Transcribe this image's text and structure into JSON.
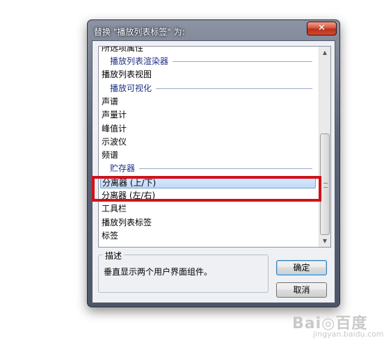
{
  "window": {
    "title": "替换 \"播放列表标签\" 为:",
    "close_glyph": "✕"
  },
  "list": {
    "partial_top_item": "所选项属性",
    "items": [
      {
        "kind": "group",
        "label": "播放列表渲染器"
      },
      {
        "kind": "item",
        "label": "播放列表视图"
      },
      {
        "kind": "group",
        "label": "播放可视化"
      },
      {
        "kind": "item",
        "label": "声谱"
      },
      {
        "kind": "item",
        "label": "声量计"
      },
      {
        "kind": "item",
        "label": "峰值计"
      },
      {
        "kind": "item",
        "label": "示波仪"
      },
      {
        "kind": "item",
        "label": "频谱"
      },
      {
        "kind": "group",
        "label": "贮存器"
      },
      {
        "kind": "item",
        "label": "分离器 (上/下)",
        "selected": true
      },
      {
        "kind": "item",
        "label": "分离器 (左/右)"
      },
      {
        "kind": "item",
        "label": "工具栏"
      },
      {
        "kind": "item",
        "label": "播放列表标签"
      },
      {
        "kind": "item",
        "label": "标签"
      }
    ]
  },
  "description": {
    "legend": "描述",
    "text": "垂直显示两个用户界面组件。"
  },
  "buttons": {
    "ok": "确定",
    "cancel": "取消"
  },
  "scrollbar": {
    "up_glyph": "▲",
    "down_glyph": "▼",
    "thumb_icon": "grip-icon"
  },
  "annotation": {
    "highlight_color": "#d0121b"
  },
  "watermark": {
    "main": "Bai◎百度",
    "sub": "jingyan.baidu.com"
  }
}
